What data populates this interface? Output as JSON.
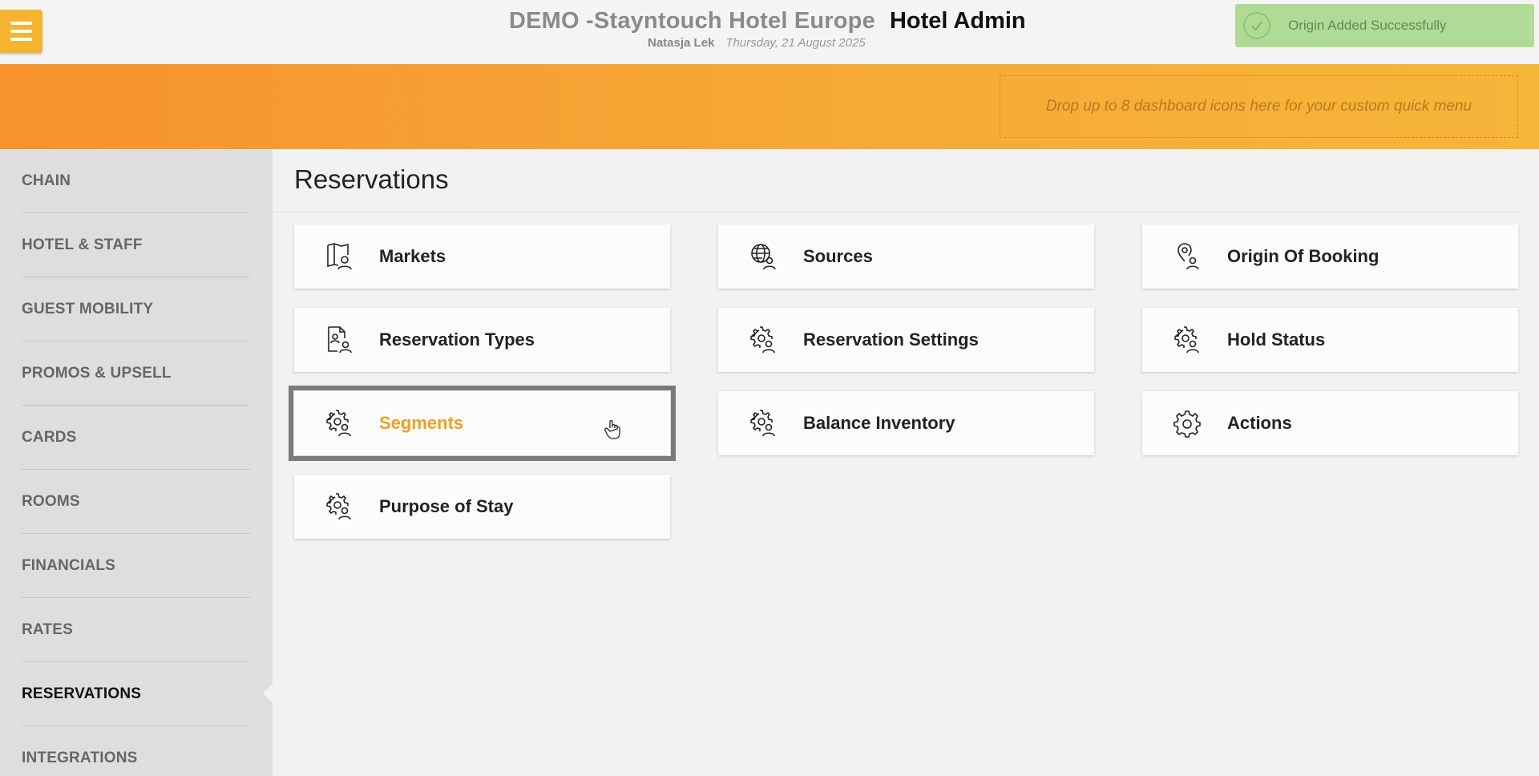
{
  "header": {
    "menu_label": "Menu",
    "hotel_name": "DEMO -Stayntouch Hotel Europe",
    "app_name": "Hotel Admin",
    "user_name": "Natasja Lek",
    "date": "Thursday, 21 August 2025"
  },
  "toast": {
    "message": "Origin Added Successfully",
    "icon": "check-circle-icon",
    "color": "#a9d98c"
  },
  "banner": {
    "dropzone_text": "Drop up to 8 dashboard icons here for your custom quick menu",
    "gradient_start": "#f7922e",
    "gradient_end": "#f6b63a"
  },
  "sidebar": {
    "items": [
      {
        "label": "CHAIN"
      },
      {
        "label": "HOTEL & STAFF"
      },
      {
        "label": "GUEST MOBILITY"
      },
      {
        "label": "PROMOS & UPSELL"
      },
      {
        "label": "CARDS"
      },
      {
        "label": "ROOMS"
      },
      {
        "label": "FINANCIALS"
      },
      {
        "label": "RATES"
      },
      {
        "label": "RESERVATIONS",
        "active": true
      },
      {
        "label": "INTEGRATIONS"
      }
    ]
  },
  "main": {
    "title": "Reservations",
    "tiles": [
      {
        "label": "Markets",
        "icon": "map-person-icon"
      },
      {
        "label": "Sources",
        "icon": "globe-person-icon"
      },
      {
        "label": "Origin Of Booking",
        "icon": "pin-person-icon"
      },
      {
        "label": "Reservation Types",
        "icon": "document-person-icon"
      },
      {
        "label": "Reservation Settings",
        "icon": "gear-person-icon"
      },
      {
        "label": "Hold Status",
        "icon": "gear-person-icon"
      },
      {
        "label": "Segments",
        "icon": "gear-person-icon",
        "selected": true
      },
      {
        "label": "Balance Inventory",
        "icon": "gear-person-icon"
      },
      {
        "label": "Actions",
        "icon": "gear-icon"
      },
      {
        "label": "Purpose of Stay",
        "icon": "gear-person-icon"
      }
    ],
    "accent_color": "#e8a128"
  }
}
